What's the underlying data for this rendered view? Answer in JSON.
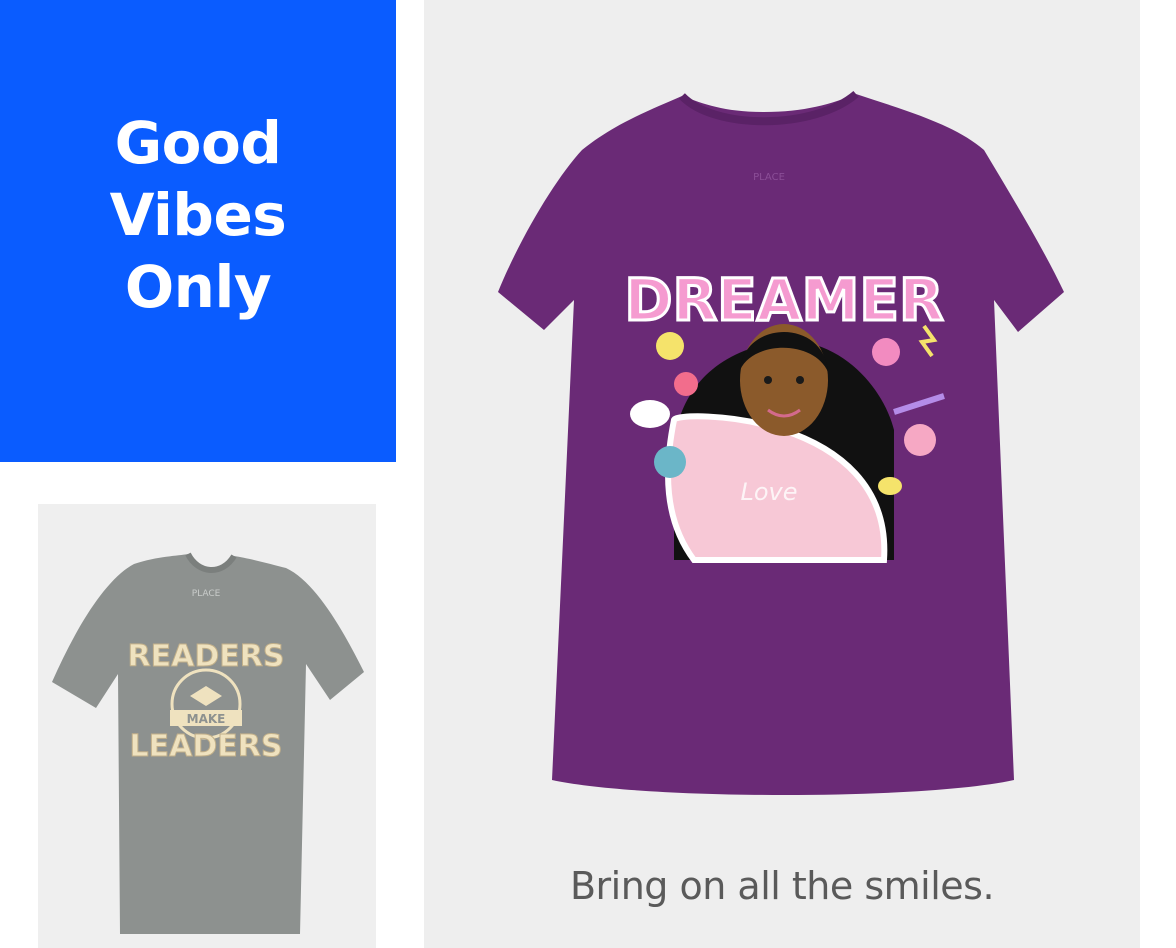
{
  "promo": {
    "headline_line1": "Good",
    "headline_line2": "Vibes",
    "headline_line3": "Only",
    "background": "#0a5cff"
  },
  "gray_tee": {
    "print_top": "READERS",
    "print_mid": "MAKE",
    "print_bottom": "LEADERS",
    "brand_tag": "PLACE",
    "color": "#8a8f8c"
  },
  "purple_tee": {
    "print_title": "DREAMER",
    "sweater_text": "Love",
    "brand_tag": "PLACE",
    "color": "#6a2a76"
  },
  "tagline": "Bring on all the smiles."
}
